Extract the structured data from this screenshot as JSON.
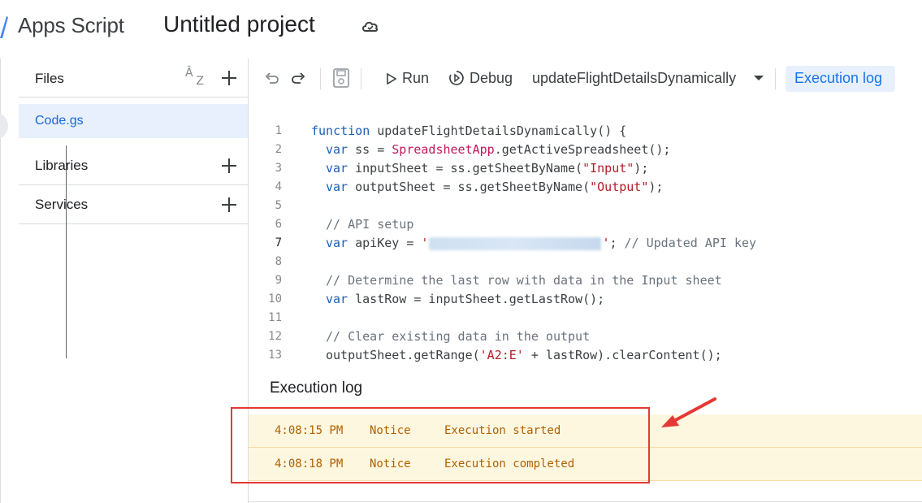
{
  "header": {
    "app_name": "Apps Script",
    "project_title": "Untitled project",
    "icons": [
      "apps-script-logo-icon",
      "cloud-saved-icon"
    ]
  },
  "sidebar": {
    "files_label": "Files",
    "files": [
      {
        "name": "Code.gs",
        "selected": true
      }
    ],
    "libraries_label": "Libraries",
    "services_label": "Services"
  },
  "toolbar": {
    "run_label": "Run",
    "debug_label": "Debug",
    "function_select": "updateFlightDetailsDynamically",
    "execution_log_label": "Execution log"
  },
  "editor": {
    "active_line": 7,
    "lines": [
      {
        "n": "1",
        "text": "function updateFlightDetailsDynamically() {"
      },
      {
        "n": "2",
        "text": "var ss = SpreadsheetApp.getActiveSpreadsheet();"
      },
      {
        "n": "3",
        "text": "var inputSheet = ss.getSheetByName(\"Input\");"
      },
      {
        "n": "4",
        "text": "var outputSheet = ss.getSheetByName(\"Output\");"
      },
      {
        "n": "5",
        "text": ""
      },
      {
        "n": "6",
        "text": "// API setup"
      },
      {
        "n": "7",
        "text": "var apiKey = '"
      },
      {
        "n": "8",
        "text": ""
      },
      {
        "n": "9",
        "text": "// Determine the last row with data in the Input sheet"
      },
      {
        "n": "10",
        "text": "var lastRow = inputSheet.getLastRow();"
      },
      {
        "n": "11",
        "text": ""
      },
      {
        "n": "12",
        "text": "// Clear existing data in the output"
      },
      {
        "n": "13",
        "text": "outputSheet.getRange('A2:E' + lastRow).clearContent();"
      }
    ],
    "line7_suffix": "'; // Updated API key"
  },
  "log": {
    "title": "Execution log",
    "entries": [
      {
        "time": "4:08:15 PM",
        "severity": "Notice",
        "message": "Execution started"
      },
      {
        "time": "4:08:18 PM",
        "severity": "Notice",
        "message": "Execution completed"
      }
    ]
  },
  "colors": {
    "accent": "#1a73e8",
    "selected_file_bg": "#e8f0fe",
    "log_row_bg": "#fef7e0",
    "log_text": "#b06000",
    "annotation_red": "#e53935"
  }
}
